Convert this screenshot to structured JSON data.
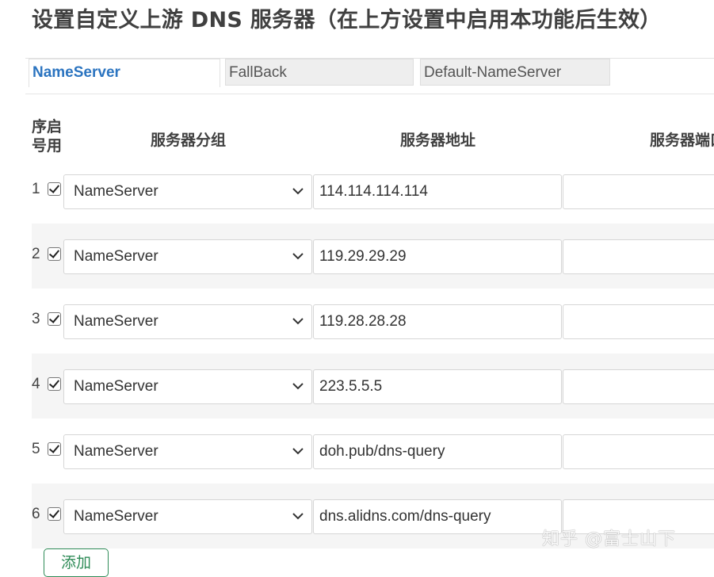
{
  "page": {
    "title": "设置自定义上游 DNS 服务器（在上方设置中启用本功能后生效）"
  },
  "tabs": [
    {
      "label": "NameServer",
      "active": true
    },
    {
      "label": "FallBack",
      "active": false
    },
    {
      "label": "Default-NameServer",
      "active": false
    }
  ],
  "table": {
    "headers": {
      "index_enable_line1": "序启",
      "index_enable_line2": "号用",
      "group": "服务器分组",
      "address": "服务器地址",
      "port": "服务器端口"
    },
    "rows": [
      {
        "index": "1",
        "enabled": true,
        "group": "NameServer",
        "address": "114.114.114.114",
        "port": ""
      },
      {
        "index": "2",
        "enabled": true,
        "group": "NameServer",
        "address": "119.29.29.29",
        "port": ""
      },
      {
        "index": "3",
        "enabled": true,
        "group": "NameServer",
        "address": "119.28.28.28",
        "port": ""
      },
      {
        "index": "4",
        "enabled": true,
        "group": "NameServer",
        "address": "223.5.5.5",
        "port": ""
      },
      {
        "index": "5",
        "enabled": true,
        "group": "NameServer",
        "address": "doh.pub/dns-query",
        "port": ""
      },
      {
        "index": "6",
        "enabled": true,
        "group": "NameServer",
        "address": "dns.alidns.com/dns-query",
        "port": ""
      }
    ]
  },
  "actions": {
    "add_label": "添加"
  },
  "watermark": {
    "text": "知乎 @富士山下"
  },
  "colors": {
    "tab_active": "#2b74c0",
    "add_button": "#2e8b57",
    "row_alt_bg": "#f5f5f5"
  }
}
